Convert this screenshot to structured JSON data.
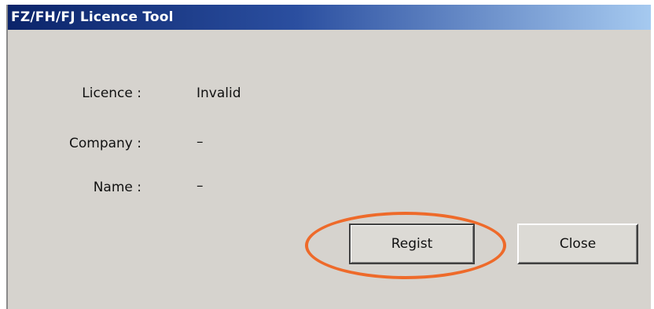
{
  "window": {
    "title": "FZ/FH/FJ Licence Tool"
  },
  "fields": {
    "licence": {
      "label": "Licence :",
      "value": "Invalid"
    },
    "company": {
      "label": "Company :",
      "value": "–"
    },
    "name": {
      "label": "Name :",
      "value": "–"
    }
  },
  "buttons": {
    "regist": "Regist",
    "close": "Close"
  },
  "colors": {
    "dialog_background": "#d6d3ce",
    "titlebar_start": "#0b246a",
    "titlebar_end": "#a6caf0",
    "highlight": "#ee6a2a"
  }
}
